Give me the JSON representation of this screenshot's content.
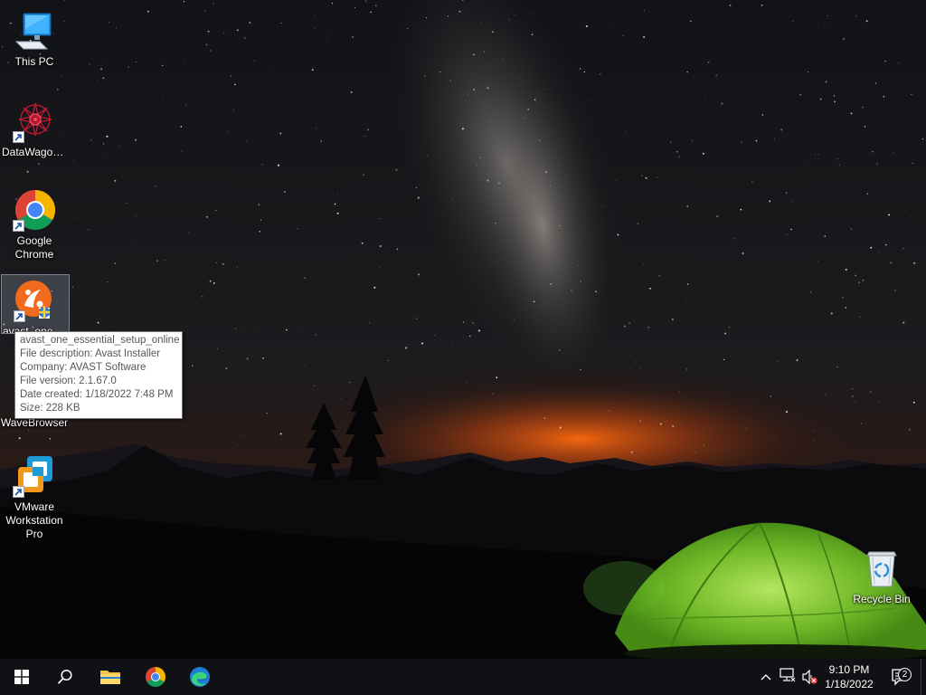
{
  "desktop": {
    "icons": [
      {
        "label": "This PC",
        "icon": "computer-icon",
        "shortcut": false
      },
      {
        "label": "DataWagon...",
        "icon": "datawagon-icon",
        "shortcut": true
      },
      {
        "label": "Google Chrome",
        "icon": "chrome-icon",
        "shortcut": true
      },
      {
        "label": "avast_one_e...",
        "icon": "avast-icon",
        "shortcut": true,
        "selected": true
      },
      {
        "label": "WaveBrowser",
        "icon": "wavebrowser-icon",
        "shortcut": true
      },
      {
        "label": "VMware Workstation Pro",
        "icon": "vmware-icon",
        "shortcut": true
      },
      {
        "label": "Recycle Bin",
        "icon": "recycle-bin-icon",
        "shortcut": false
      }
    ],
    "tooltip": {
      "lines": [
        "avast_one_essential_setup_online",
        "File description: Avast Installer",
        "Company: AVAST Software",
        "File version: 2.1.67.0",
        "Date created: 1/18/2022 7:48 PM",
        "Size: 228 KB"
      ]
    }
  },
  "taskbar": {
    "pinned": [
      {
        "name": "start",
        "icon": "windows-logo-icon"
      },
      {
        "name": "search",
        "icon": "search-icon"
      },
      {
        "name": "file-explorer",
        "icon": "folder-icon"
      },
      {
        "name": "chrome",
        "icon": "chrome-icon"
      },
      {
        "name": "edge",
        "icon": "edge-icon"
      }
    ],
    "tray": {
      "icons": [
        "chevron-up-icon",
        "network-icon",
        "volume-muted-icon"
      ],
      "time": "9:10 PM",
      "date": "1/18/2022",
      "notification_count": "2"
    }
  },
  "colors": {
    "taskbar": "#101114",
    "tooltip_bg": "#ffffff",
    "tooltip_text": "#575757",
    "tent_green": "#8fe83a",
    "horizon_glow": "#f0640f"
  }
}
